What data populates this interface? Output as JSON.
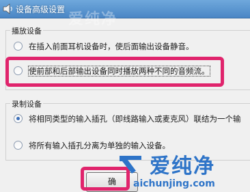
{
  "window": {
    "title": "设备高级设置",
    "watermark_text": "爱纯净"
  },
  "playback_group": {
    "label": "播放设备",
    "options": [
      {
        "label": "在插入前面耳机设备时，使后面输出设备静音。",
        "checked": false
      },
      {
        "label": "使前部和后部输出设备同时播放两种不同的音频流。",
        "checked": false
      }
    ]
  },
  "recording_group": {
    "label": "录制设备",
    "options": [
      {
        "label": "将相同类型的输入插孔（即线路输入或麦克风）联结为一个输",
        "checked": true
      },
      {
        "label": "将所有输入插孔分离为单独的输入设备。",
        "checked": false
      }
    ]
  },
  "buttons": {
    "ok_label": "确"
  },
  "watermark": {
    "name": "爱纯净",
    "url": "aichunjing.com"
  },
  "colors": {
    "highlight": "#e0246c",
    "title_bar": "#4a86c5",
    "watermark": "#2e74c8"
  }
}
